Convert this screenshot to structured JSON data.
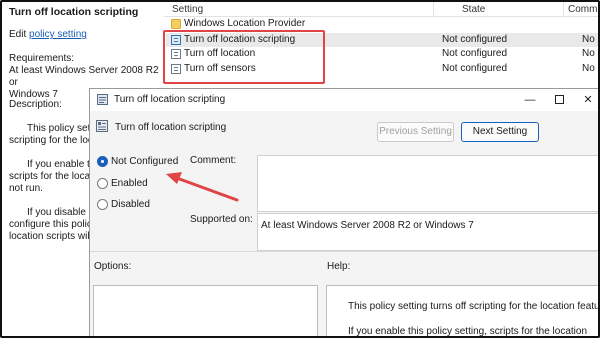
{
  "left_pane": {
    "title": "Turn off location scripting",
    "edit_prefix": "Edit ",
    "edit_link": "policy setting",
    "requirements_label": "Requirements:",
    "requirements_line1": "At least Windows Server 2008 R2 or",
    "requirements_line2": "Windows 7",
    "description_label": "Description:",
    "para1_line1": "This policy setting",
    "para1_line2": "scripting for the loca",
    "para2_line1": "If you enable th",
    "para2_line2": "scripts for the locati",
    "para2_line3": "not run.",
    "para3_line1": "If you disable or",
    "para3_line2": "configure this policy",
    "para3_line3": "location scripts will r"
  },
  "list": {
    "columns": [
      "Setting",
      "State",
      "Comme"
    ],
    "rows": [
      {
        "name": "Windows Location Provider",
        "state": "",
        "comment": "",
        "icon": "folder-icon"
      },
      {
        "name": "Turn off location scripting",
        "state": "Not configured",
        "comment": "No",
        "icon": "policy-icon"
      },
      {
        "name": "Turn off location",
        "state": "Not configured",
        "comment": "No",
        "icon": "policy-icon"
      },
      {
        "name": "Turn off sensors",
        "state": "Not configured",
        "comment": "No",
        "icon": "policy-icon"
      }
    ]
  },
  "dialog": {
    "window_title": "Turn off location scripting",
    "header_title": "Turn off location scripting",
    "prev_button": "Previous Setting",
    "next_button": "Next Setting",
    "options": {
      "not_configured": "Not Configured",
      "enabled": "Enabled",
      "disabled": "Disabled",
      "selected": "not_configured"
    },
    "comment_label": "Comment:",
    "supported_label": "Supported on:",
    "supported_value": "At least Windows Server 2008 R2 or Windows 7",
    "options_label": "Options:",
    "help_label": "Help:",
    "help_line1": "This policy setting turns off scripting for the location feature.",
    "help_line2": "If you enable this policy setting, scripts for the location"
  },
  "colors": {
    "accent": "#1b5fbd",
    "annotation": "#e04444"
  }
}
